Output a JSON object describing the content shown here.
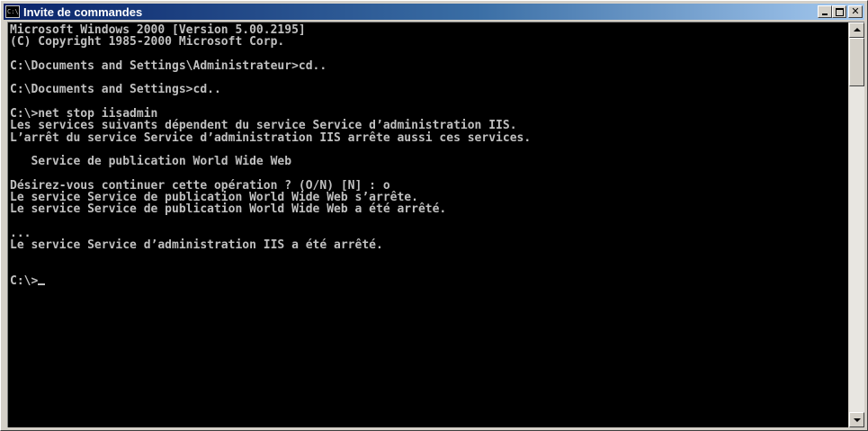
{
  "window": {
    "title": "Invite de commandes",
    "icon": "console-icon",
    "icon_label": "C:\\",
    "buttons": {
      "minimize": "minimize-icon",
      "maximize": "maximize-icon",
      "close": "close-icon"
    }
  },
  "colors": {
    "console_bg": "#000000",
    "console_fg": "#c0c0c0",
    "titlebar_start": "#0a246a",
    "titlebar_end": "#a6caf0"
  },
  "console": {
    "lines": [
      "Microsoft Windows 2000 [Version 5.00.2195]",
      "(C) Copyright 1985-2000 Microsoft Corp.",
      "",
      "C:\\Documents and Settings\\Administrateur>cd..",
      "",
      "C:\\Documents and Settings>cd..",
      "",
      "C:\\>net stop iisadmin",
      "Les services suivants dépendent du service Service d’administration IIS.",
      "L’arrêt du service Service d’administration IIS arrête aussi ces services.",
      "",
      "   Service de publication World Wide Web",
      "",
      "Désirez-vous continuer cette opération ? (O/N) [N] : o",
      "Le service Service de publication World Wide Web s’arrête.",
      "Le service Service de publication World Wide Web a été arrêté.",
      "",
      "...",
      "Le service Service d’administration IIS a été arrêté.",
      "",
      "",
      "C:\\>"
    ]
  }
}
